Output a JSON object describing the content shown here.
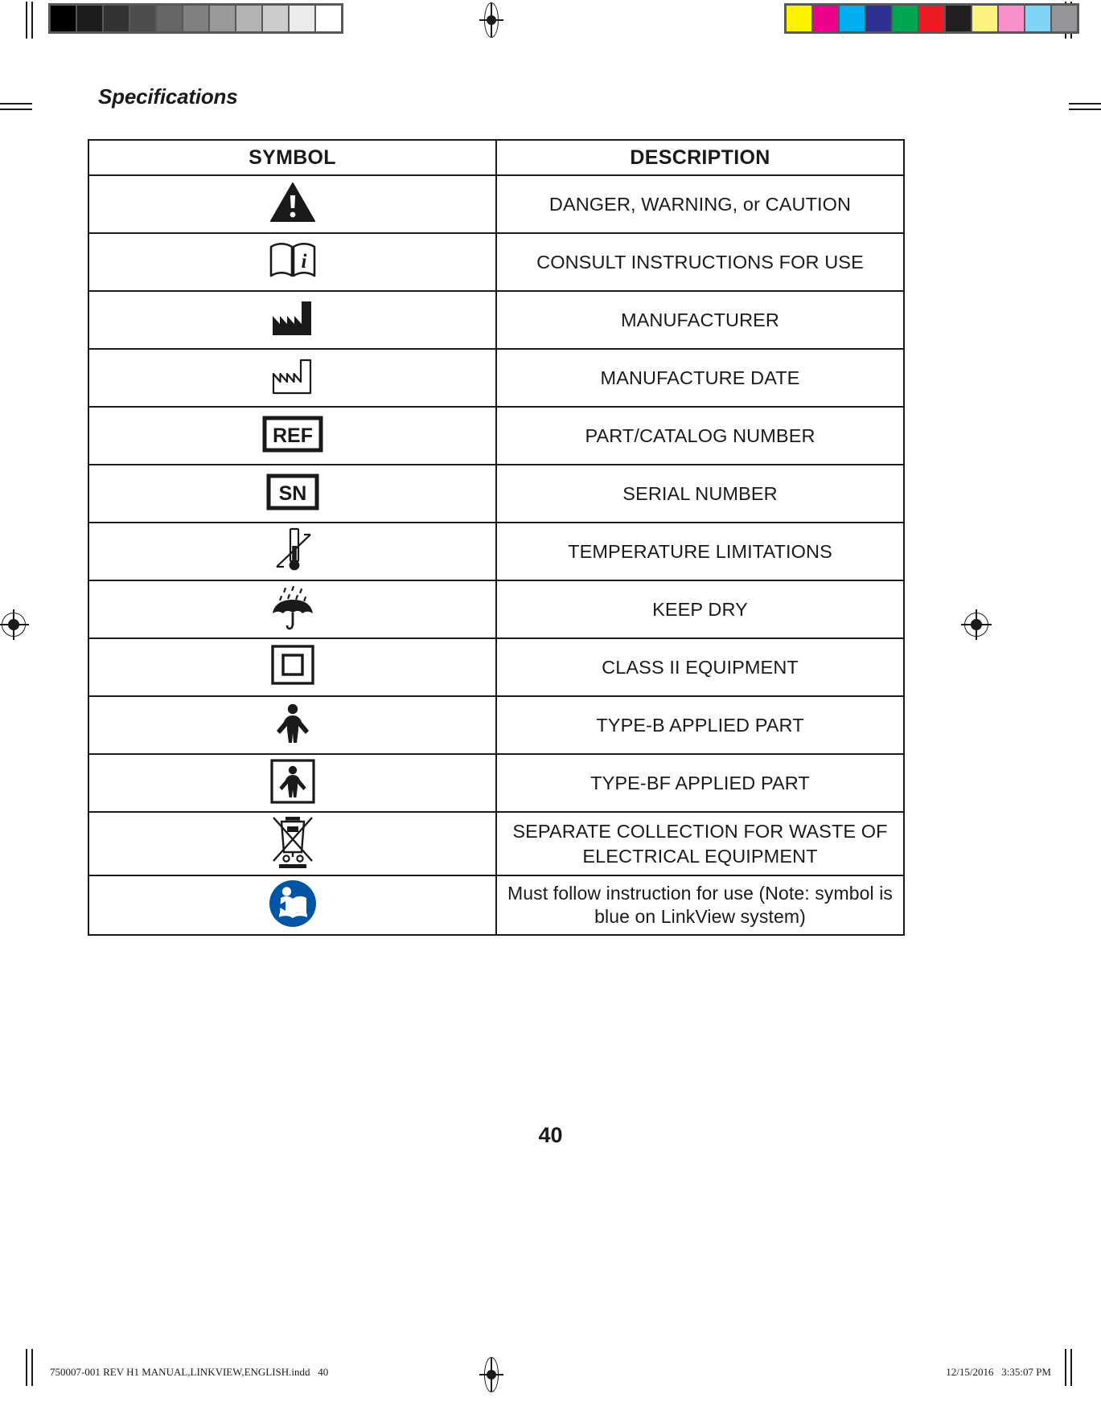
{
  "document": {
    "section_title": "Specifications",
    "page_number": "40"
  },
  "calibration": {
    "grayscale_label": "grayscale-calibration-bar",
    "grayscale_swatches": [
      "#000000",
      "#1c1c1c",
      "#333333",
      "#4d4d4d",
      "#666666",
      "#808080",
      "#999999",
      "#b3b3b3",
      "#cccccc",
      "#ebebeb",
      "#ffffff"
    ],
    "color_label": "color-calibration-bar",
    "color_swatches": [
      "#fff200",
      "#ec008c",
      "#00aeef",
      "#2e3192",
      "#00a651",
      "#ed1c24",
      "#231f20",
      "#fff380",
      "#f островf"
    ]
  },
  "table": {
    "headers": {
      "symbol": "SYMBOL",
      "description": "DESCRIPTION"
    },
    "rows": [
      {
        "icon": "warning-triangle-icon",
        "description": "DANGER, WARNING, or CAUTION"
      },
      {
        "icon": "consult-instructions-icon",
        "description": "CONSULT INSTRUCTIONS FOR USE"
      },
      {
        "icon": "manufacturer-factory-icon",
        "description": "MANUFACTURER"
      },
      {
        "icon": "manufacture-date-factory-icon",
        "description": "MANUFACTURE DATE"
      },
      {
        "icon": "ref-catalog-number-icon",
        "description": "PART/CATALOG NUMBER",
        "icon_text": "REF"
      },
      {
        "icon": "sn-serial-number-icon",
        "description": "SERIAL NUMBER",
        "icon_text": "SN"
      },
      {
        "icon": "temperature-limitation-icon",
        "description": "TEMPERATURE LIMITATIONS"
      },
      {
        "icon": "keep-dry-umbrella-icon",
        "description": "KEEP DRY"
      },
      {
        "icon": "class-two-equipment-icon",
        "description": "CLASS II EQUIPMENT"
      },
      {
        "icon": "type-b-applied-part-icon",
        "description": "TYPE-B APPLIED PART"
      },
      {
        "icon": "type-bf-applied-part-icon",
        "description": "TYPE-BF APPLIED PART"
      },
      {
        "icon": "weee-crossed-bin-icon",
        "description": "SEPARATE COLLECTION FOR WASTE OF ELECTRICAL EQUIPMENT"
      },
      {
        "icon": "mandatory-read-instructions-icon",
        "description": "Must follow instruction for use (Note: symbol is blue on LinkView system)"
      }
    ]
  },
  "footer": {
    "file_info": "750007-001 REV H1 MANUAL,LINKVIEW,ENGLISH.indd   40",
    "timestamp": "12/15/2016   3:35:07 PM"
  },
  "colors": {
    "ink": "#1a1a1a",
    "mandatory_blue": "#0055a5",
    "strip_frame": "#58585a"
  }
}
